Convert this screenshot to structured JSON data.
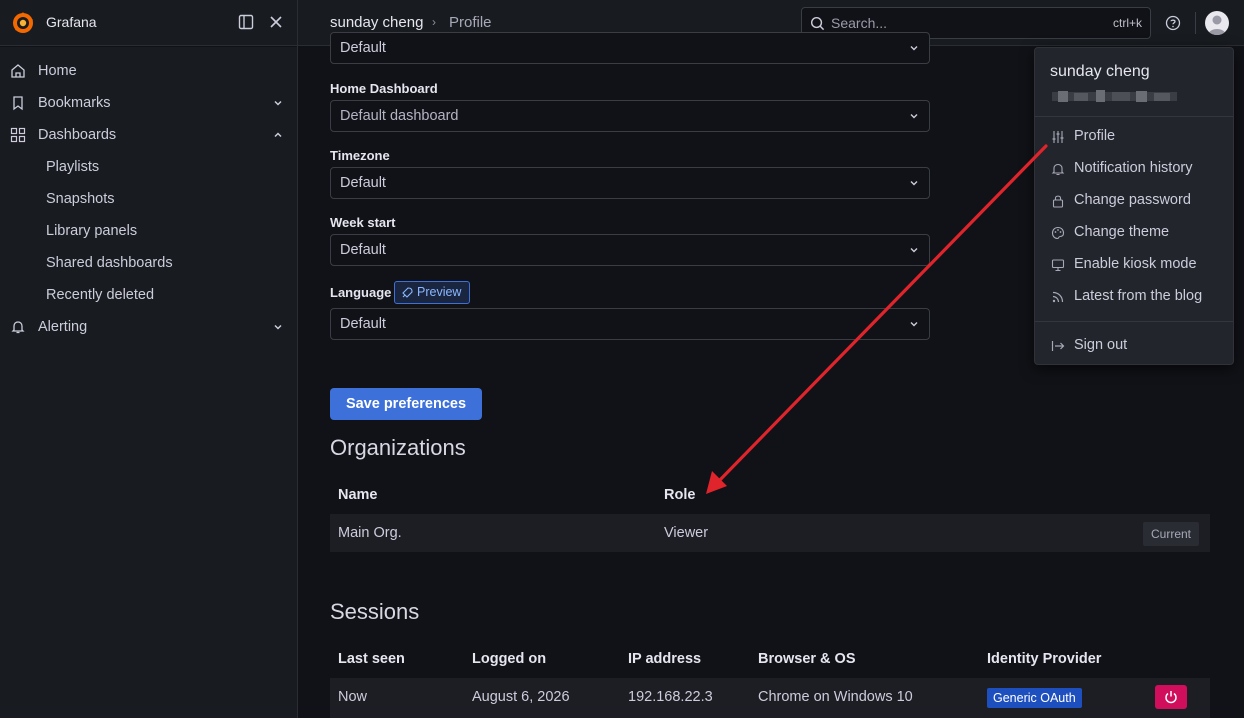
{
  "app": {
    "brand": "Grafana"
  },
  "breadcrumb": {
    "user": "sunday cheng",
    "separator": "›",
    "page": "Profile"
  },
  "search": {
    "placeholder": "Search...",
    "shortcut": "ctrl+k"
  },
  "sidebar": {
    "items": [
      {
        "label": "Home",
        "icon": "home-icon"
      },
      {
        "label": "Bookmarks",
        "icon": "bookmark-icon",
        "expanded": false
      },
      {
        "label": "Dashboards",
        "icon": "apps-icon",
        "expanded": true
      },
      {
        "label": "Playlists"
      },
      {
        "label": "Snapshots"
      },
      {
        "label": "Library panels"
      },
      {
        "label": "Shared dashboards"
      },
      {
        "label": "Recently deleted"
      },
      {
        "label": "Alerting",
        "icon": "bell-icon",
        "expanded": false
      }
    ]
  },
  "preferences": {
    "theme_value": "Default",
    "home_dashboard": {
      "label": "Home Dashboard",
      "value": "Default dashboard"
    },
    "timezone": {
      "label": "Timezone",
      "value": "Default"
    },
    "week_start": {
      "label": "Week start",
      "value": "Default"
    },
    "language": {
      "label": "Language",
      "badge": "Preview",
      "value": "Default"
    },
    "save_label": "Save preferences"
  },
  "organizations": {
    "title": "Organizations",
    "columns": [
      "Name",
      "Role"
    ],
    "rows": [
      {
        "name": "Main Org.",
        "role": "Viewer",
        "tag": "Current"
      }
    ]
  },
  "sessions": {
    "title": "Sessions",
    "columns": [
      "Last seen",
      "Logged on",
      "IP address",
      "Browser & OS",
      "Identity Provider"
    ],
    "rows": [
      {
        "last_seen": "Now",
        "logged_on": "August 6, 2026",
        "ip": "192.168.22.3",
        "browser": "Chrome on Windows 10",
        "provider": "Generic OAuth"
      }
    ]
  },
  "user_menu": {
    "name": "sunday cheng",
    "items": [
      {
        "label": "Profile",
        "icon": "sliders-icon"
      },
      {
        "label": "Notification history",
        "icon": "bell-icon"
      },
      {
        "label": "Change password",
        "icon": "lock-icon"
      },
      {
        "label": "Change theme",
        "icon": "palette-icon"
      },
      {
        "label": "Enable kiosk mode",
        "icon": "monitor-icon"
      },
      {
        "label": "Latest from the blog",
        "icon": "rss-icon"
      }
    ],
    "sign_out": "Sign out"
  },
  "colors": {
    "accent": "#3d71d9",
    "danger": "#d10e5c",
    "annotation_arrow": "#e0242b"
  }
}
